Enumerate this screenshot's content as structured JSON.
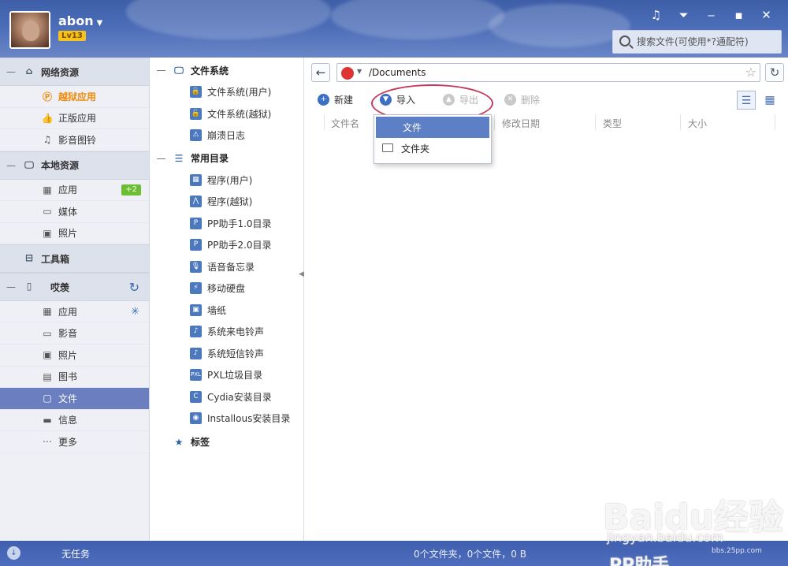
{
  "header": {
    "username": "abon",
    "level": "Lv13",
    "search_placeholder": "搜索文件(可使用*?通配符)"
  },
  "sidebar": {
    "sections": [
      {
        "label": "网络资源",
        "items": [
          {
            "label": "越狱应用",
            "active": false,
            "orange": true
          },
          {
            "label": "正版应用"
          },
          {
            "label": "影音图铃"
          }
        ]
      },
      {
        "label": "本地资源",
        "items": [
          {
            "label": "应用",
            "badge": "+2"
          },
          {
            "label": "媒体"
          },
          {
            "label": "照片"
          }
        ]
      },
      {
        "label": "工具箱",
        "items": []
      },
      {
        "label": "哎羡",
        "items": [
          {
            "label": "应用"
          },
          {
            "label": "影音"
          },
          {
            "label": "照片"
          },
          {
            "label": "图书"
          },
          {
            "label": "文件",
            "active": true
          },
          {
            "label": "信息"
          },
          {
            "label": "更多"
          }
        ]
      }
    ]
  },
  "tree": {
    "filesystem": {
      "label": "文件系统",
      "items": [
        "文件系统(用户)",
        "文件系统(越狱)",
        "崩溃日志"
      ]
    },
    "common": {
      "label": "常用目录",
      "items": [
        "程序(用户)",
        "程序(越狱)",
        "PP助手1.0目录",
        "PP助手2.0目录",
        "语音备忘录",
        "移动硬盘",
        "墙纸",
        "系统来电铃声",
        "系统短信铃声",
        "PXL垃圾目录",
        "Cydia安装目录",
        "Installous安装目录"
      ]
    },
    "tags": {
      "label": "标签"
    }
  },
  "main": {
    "path": "/Documents",
    "toolbar": {
      "new": "新建",
      "import": "导入",
      "export": "导出",
      "delete": "删除"
    },
    "columns": [
      "文件名",
      "修改日期",
      "类型",
      "大小"
    ],
    "dropdown": [
      "文件",
      "文件夹"
    ]
  },
  "status": {
    "tasks": "无任务",
    "summary": "0个文件夹，0个文件，0 B"
  },
  "watermark": {
    "brand": "Baidu经验",
    "brand2": "PP助手",
    "url": "jingyan.baidu.com",
    "url2": "bbs.25pp.com"
  },
  "colors": {
    "header": "#4b6cb7",
    "active_item": "#6b7fc0",
    "accent_orange": "#f08a0a",
    "badge_green": "#6cbf32",
    "annotation_red": "#c43a5a"
  },
  "icons": [
    "music-note-icon",
    "dropdown-menu-icon",
    "minimize-icon",
    "maximize-icon",
    "close-icon",
    "search-icon",
    "back-arrow-icon",
    "star-icon",
    "refresh-icon",
    "list-view-icon",
    "grid-view-icon",
    "sync-icon",
    "folder-icon"
  ]
}
